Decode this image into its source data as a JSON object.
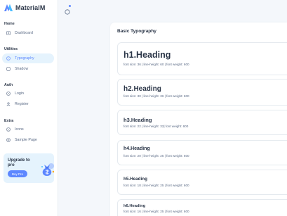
{
  "brand": {
    "name": "MaterialM"
  },
  "sidebar": {
    "sections": [
      {
        "title": "Home",
        "items": [
          {
            "label": "Dashboard",
            "icon": "dashboard-icon"
          }
        ]
      },
      {
        "title": "Utilities",
        "items": [
          {
            "label": "Typography",
            "icon": "typography-icon",
            "active": true
          },
          {
            "label": "Shadow",
            "icon": "shadow-icon"
          }
        ]
      },
      {
        "title": "Auth",
        "items": [
          {
            "label": "Login",
            "icon": "login-icon"
          },
          {
            "label": "Register",
            "icon": "register-icon"
          }
        ]
      },
      {
        "title": "Extra",
        "items": [
          {
            "label": "Icons",
            "icon": "icons-icon"
          },
          {
            "label": "Sample Page",
            "icon": "sample-page-icon"
          }
        ]
      }
    ]
  },
  "promo": {
    "title": "Upgrade to pro",
    "button": "Buy Pro"
  },
  "colors": {
    "accent": "#5d87ff",
    "active_bg": "#e5f3fd",
    "text": "#2a3547",
    "muted": "#5a6a85"
  },
  "main": {
    "title": "Basic Typography",
    "headings": [
      {
        "label": "h1.Heading",
        "meta": "font size: 36 | line-height: 60 | font weight: 600"
      },
      {
        "label": "h2.Heading",
        "meta": "font size: 30 | line-height: 36 | font weight: 600"
      },
      {
        "label": "h3.Heading",
        "meta": "font size: 22 | line-height: 32| font weight: 600"
      },
      {
        "label": "h4.Heading",
        "meta": "font size: 20 | line-height: 25 | font weight: 600"
      },
      {
        "label": "h5.Heading",
        "meta": "font size: 18 | line-height: 25 | font weight: 600"
      },
      {
        "label": "h6.Heading",
        "meta": "font size: 16 | line-height: 25 | font weight: 600"
      }
    ]
  }
}
